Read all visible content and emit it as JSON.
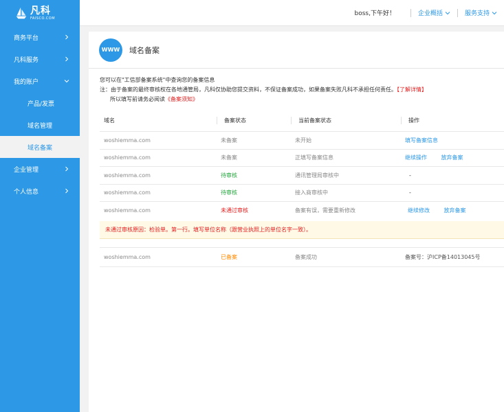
{
  "brand": {
    "name_cn": "凡科",
    "name_en": "FAISCO.COM",
    "accent": "#2c98e6"
  },
  "sidebar": {
    "items": [
      {
        "label": "商务平台"
      },
      {
        "label": "凡科服务"
      },
      {
        "label": "我的账户"
      },
      {
        "label": "产品/发票"
      },
      {
        "label": "域名管理"
      },
      {
        "label": "域名备案"
      },
      {
        "label": "企业管理"
      },
      {
        "label": "个人信息"
      }
    ]
  },
  "topbar": {
    "greeting": "boss,下午好！",
    "links": [
      "企业概括",
      "服务支持"
    ]
  },
  "page": {
    "icon_text": "WWW",
    "title": "域名备案"
  },
  "notice": {
    "line1": "您可以在\"工信部备案系统\"中查询您的备案信息",
    "line2": "注：由于备案的最终审核权在各地通管局，凡科仅协助您提交资料，不保证备案成功，如果备案失败凡科不承担任何责任。",
    "line2_link": "【了解详情】",
    "line3": "所以填写前请务必阅读",
    "line3_link": "《备案须知》"
  },
  "table": {
    "headers": [
      "域名",
      "备案状态",
      "当前备案状态",
      "操作"
    ],
    "rows": [
      {
        "domain": "woshiemma.com",
        "status": "未备案",
        "current": "未开始",
        "op1": "填写备案信息",
        "op2": ""
      },
      {
        "domain": "woshiemma.com",
        "status": "未备案",
        "current": "正填写备案信息",
        "op1": "继续操作",
        "op2": "放弃备案"
      },
      {
        "domain": "woshiemma.com",
        "status": "待审核",
        "current": "通讯管理局审核中",
        "op1": "-",
        "op2": ""
      },
      {
        "domain": "woshiemma.com",
        "status": "待审核",
        "current": "接入商审核中",
        "op1": "-",
        "op2": ""
      },
      {
        "domain": "woshiemma.com",
        "status": "未通过审核",
        "current": "备案有误，需要重新修改",
        "op1": "继续修改",
        "op2": "放弃备案"
      }
    ],
    "reason": "未通过审核原因：检验单。第一行。填写单位名称（跟营业执照上的单位名字一致）。",
    "last_row": {
      "domain": "woshiemma.com",
      "status": "已备案",
      "current": "备案成功",
      "op1": "备案号：沪ICP备14013045号"
    }
  }
}
